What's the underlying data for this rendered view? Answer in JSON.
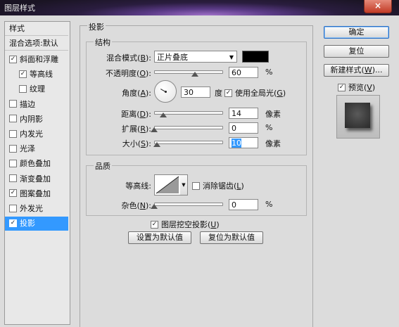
{
  "window": {
    "title": "图层样式",
    "close_glyph": "×"
  },
  "style_list": {
    "header": "样式",
    "blending_header": "混合选项:默认",
    "items": [
      {
        "label": "斜面和浮雕",
        "checked": true,
        "indent": false,
        "selected": false
      },
      {
        "label": "等高线",
        "checked": true,
        "indent": true,
        "selected": false
      },
      {
        "label": "纹理",
        "checked": false,
        "indent": true,
        "selected": false
      },
      {
        "label": "描边",
        "checked": false,
        "indent": false,
        "selected": false
      },
      {
        "label": "内阴影",
        "checked": false,
        "indent": false,
        "selected": false
      },
      {
        "label": "内发光",
        "checked": false,
        "indent": false,
        "selected": false
      },
      {
        "label": "光泽",
        "checked": false,
        "indent": false,
        "selected": false
      },
      {
        "label": "颜色叠加",
        "checked": false,
        "indent": false,
        "selected": false
      },
      {
        "label": "渐变叠加",
        "checked": false,
        "indent": false,
        "selected": false
      },
      {
        "label": "图案叠加",
        "checked": true,
        "indent": false,
        "selected": false
      },
      {
        "label": "外发光",
        "checked": false,
        "indent": false,
        "selected": false
      },
      {
        "label": "投影",
        "checked": true,
        "indent": false,
        "selected": true
      }
    ]
  },
  "drop_shadow": {
    "section_title": "投影",
    "structure": {
      "title": "结构",
      "blend_mode_label": "混合模式(",
      "blend_mode_key": "B",
      "blend_mode_label_end": "):",
      "blend_mode_value": "正片叠底",
      "shadow_color": "#000000",
      "opacity_label": "不透明度(",
      "opacity_key": "O",
      "opacity_label_end": "):",
      "opacity_value": "60",
      "opacity_level_percent": 60,
      "percent_unit": "%",
      "angle_label": "角度(",
      "angle_key": "A",
      "angle_label_end": "):",
      "angle_value": "30",
      "angle_unit": "度",
      "use_global_light_checked": true,
      "use_global_light_label": "使用全局光(",
      "use_global_light_key": "G",
      "use_global_light_end": ")",
      "distance_label": "距离(",
      "distance_key": "D",
      "distance_label_end": "):",
      "distance_value": "14",
      "distance_level_percent": 14,
      "pixel_unit": "像素",
      "spread_label": "扩展(",
      "spread_key": "R",
      "spread_label_end": "):",
      "spread_value": "0",
      "spread_level_percent": 0,
      "size_label": "大小(",
      "size_key": "S",
      "size_label_end": "):",
      "size_value": "10",
      "size_level_percent": 4
    },
    "quality": {
      "title": "品质",
      "contour_label": "等高线:",
      "anti_alias_checked": false,
      "anti_alias_label": "消除锯齿(",
      "anti_alias_key": "L",
      "anti_alias_end": ")",
      "noise_label": "杂色(",
      "noise_key": "N",
      "noise_label_end": "):",
      "noise_value": "0",
      "noise_level_percent": 0
    },
    "knockout_checked": true,
    "knockout_label": "图层挖空投影(",
    "knockout_key": "U",
    "knockout_end": ")",
    "make_default_label": "设置为默认值",
    "reset_default_label": "复位为默认值"
  },
  "right_panel": {
    "ok_label": "确定",
    "reset_label": "复位",
    "new_style_label": "新建样式(",
    "new_style_key": "W",
    "new_style_end": ")...",
    "preview_checked": true,
    "preview_label": "预览(",
    "preview_key": "V",
    "preview_end": ")"
  },
  "icons": {
    "check": "✓",
    "dropdown": "▼"
  }
}
